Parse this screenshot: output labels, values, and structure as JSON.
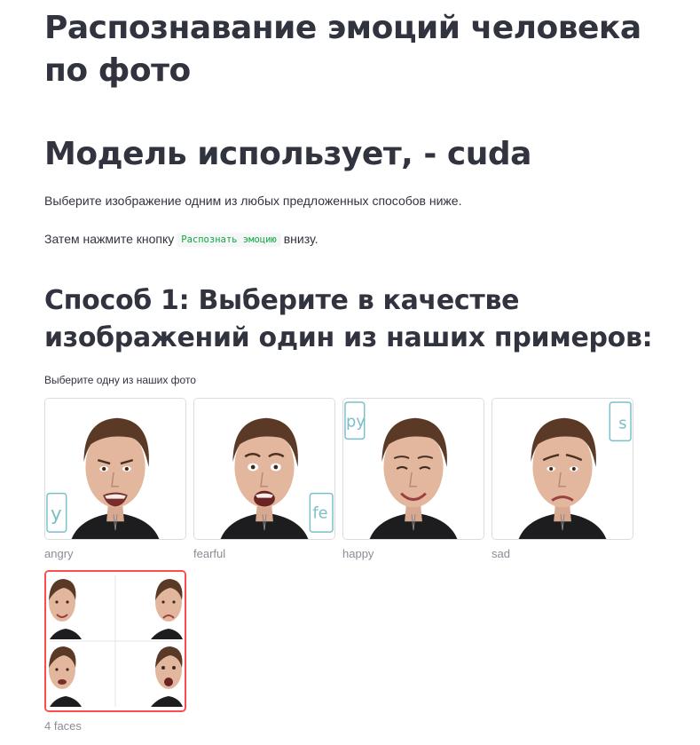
{
  "page": {
    "title": "Распознавание эмоций человека по фото",
    "model_heading": "Модель использует, - cuda",
    "instruction_1": "Выберите изображение одним из любых предложенных способов ниже.",
    "instruction_2_before": "Затем нажмите кнопку",
    "instruction_2_code": "Распознать эмоцию",
    "instruction_2_after": "внизу."
  },
  "method1": {
    "heading": "Способ 1: Выберите в качестве изображений один из наших примеров:",
    "picker_label": "Выберите одну из наших фото"
  },
  "gallery": [
    {
      "caption": "angry",
      "icon": "angry-face-photo",
      "selected": false
    },
    {
      "caption": "fearful",
      "icon": "fearful-face-photo",
      "selected": false
    },
    {
      "caption": "happy",
      "icon": "happy-face-photo",
      "selected": false
    },
    {
      "caption": "sad",
      "icon": "sad-face-photo",
      "selected": false
    },
    {
      "caption": "4 faces",
      "icon": "four-faces-photo",
      "selected": true
    }
  ],
  "colors": {
    "text": "#31333f",
    "caption": "#8a8d96",
    "code_text": "#09ab3b",
    "selected_border": "#ff4b4b",
    "card_border": "#d9dbe0"
  }
}
